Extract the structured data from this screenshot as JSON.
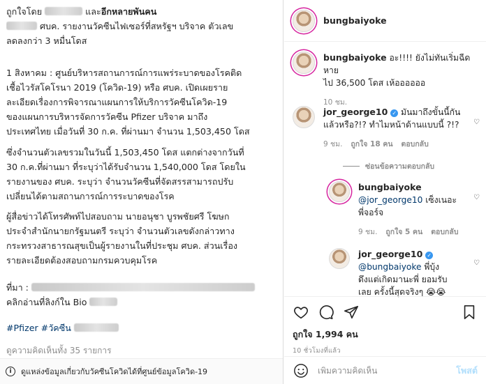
{
  "caption": {
    "liked_by_prefix": "ถูกใจโดย",
    "liked_by_and": "และ",
    "liked_by_others": "อีกหลายพันคน",
    "l1_suffix": "ศบค. รายงานวัคซีนไฟเซอร์ที่สหรัฐฯ บริจาค ตัวเลข",
    "l2": "ลดลงกว่า 3 หมื่นโดส",
    "p1": [
      "1 สิงหาคม : ศูนย์บริหารสถานการณ์การแพร่ระบาดของโรคติด",
      "เชื้อไวรัสโคโรนา 2019 (โควิด-19) หรือ ศบค. เปิดเผยราย",
      "ละเอียดเรื่องการพิจารณาแผนการให้บริการวัคซีนโควิด-19",
      "ของแผนการบริหารจัดการวัคซีน Pfizer บริจาค มาถึง",
      "ประเทศไทย เมื่อวันที่ 30 ก.ค. ที่ผ่านมา จำนวน 1,503,450 โดส"
    ],
    "p2": [
      "ซึ่งจำนวนตัวเลขรวมในวันนี้ 1,503,450 โดส แตกต่างจากวันที่",
      "30 ก.ค.ที่ผ่านมา ที่ระบุว่าได้รับจำนวน 1,540,000 โดส โดยใน",
      "รายงานของ ศบค. ระบุว่า จำนวนวัคซีนที่จัดสรรสามารถปรับ",
      "เปลี่ยนได้ตามสถานการณ์การระบาดของโรค"
    ],
    "p3": [
      "ผู้สื่อข่าวได้โทรศัพท์ไปสอบถาม นายอนุชา บูรพชัยศรี โฆษก",
      "ประจำสำนักนายกรัฐมนตรี ระบุว่า จำนวนตัวเลขดังกล่าวทาง",
      "กระทรวงสาธารณสุขเป็นผู้รายงานในที่ประชุม ศบค. ส่วนเรื่อง",
      "รายละเอียดต้องสอบถามกรมควบคุมโรค"
    ],
    "source_label": "ที่มา :",
    "click_line": "คลิกอ่านที่ลิงก์ใน Bio",
    "hashtag1": "#Pfizer",
    "hashtag2": "#วัคซีน",
    "view_all_comments": "ดูความคิดเห็นทั้ง 35 รายการ",
    "info_text": "ดูแหล่งข้อมูลเกี่ยวกับวัคซีนโควิดได้ที่ศูนย์ข้อมูลโควิด-19"
  },
  "sidebar": {
    "header_username": "bungbaiyoke",
    "comments": [
      {
        "username": "bungbaiyoke",
        "text1": "อะ!!!! ยังไม่ทันเริ่มฉีด หาย",
        "text2": "ไป 36,500 โดส เห้ออออออ",
        "time": "10 ชม."
      },
      {
        "username": "jor_george10",
        "text1": "มันมาถึงขั้นนี้กัน",
        "text2": "แล้วหรือ?!? ทำไมหน้าด้านแบบนี้ ?!?",
        "time": "9 ชม.",
        "likes": "ถูกใจ 18 คน",
        "reply": "ตอบกลับ"
      }
    ],
    "hide_replies": "ซ่อนข้อความตอบกลับ",
    "replies": [
      {
        "username": "bungbaiyoke",
        "mention": "@jor_george10",
        "text1": "เซ็งเนอะ",
        "text2": "พี่จอร์จ",
        "time": "9 ชม.",
        "likes": "ถูกใจ 5 คน",
        "reply": "ตอบกลับ"
      },
      {
        "username": "jor_george10",
        "mention": "@bungbaiyoke",
        "text1": "พี่บุ้ง",
        "text2": "ดึงแต่เกิดมานะพี่ ยอมรับ",
        "text3": "เลย ครั้งนี้สุดจริงๆ",
        "emoji": "😭😭"
      }
    ],
    "likes_count": "ถูกใจ 1,994 คน",
    "posted_time": "10 ชั่วโมงที่แล้ว",
    "comment_placeholder": "เพิ่มความคิดเห็น",
    "post_button": "โพสต์"
  },
  "icons": [
    "heart-icon",
    "comment-icon",
    "share-icon",
    "bookmark-icon",
    "emoji-icon",
    "verified-icon",
    "info-icon"
  ],
  "colors": {
    "verified": "#3897f0",
    "mention": "#00376b",
    "muted": "#8e8e8e",
    "post_button_disabled": "#b2dffc"
  }
}
